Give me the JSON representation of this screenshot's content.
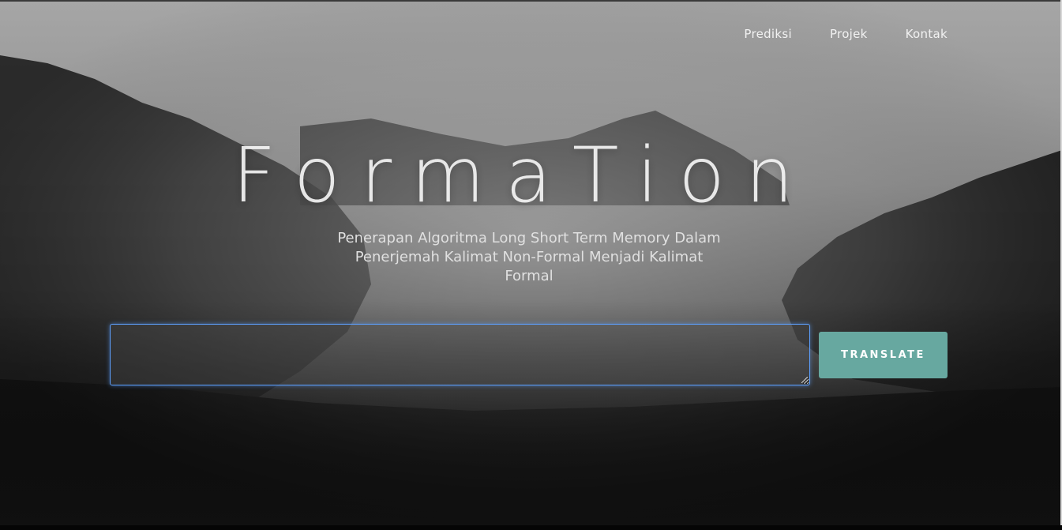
{
  "nav": {
    "items": [
      {
        "label": "Prediksi"
      },
      {
        "label": "Projek"
      },
      {
        "label": "Kontak"
      }
    ]
  },
  "hero": {
    "title": "FormaTion",
    "subtitle": "Penerapan Algoritma Long Short Term Memory Dalam Penerjemah Kalimat Non-Formal Menjadi Kalimat Formal"
  },
  "form": {
    "input_value": "",
    "button_label": "TRANSLATE"
  },
  "colors": {
    "button": "#67a8a0",
    "input_focus_border": "#5da0ff"
  },
  "icons": {
    "resize_grip": "resize-grip-icon"
  }
}
